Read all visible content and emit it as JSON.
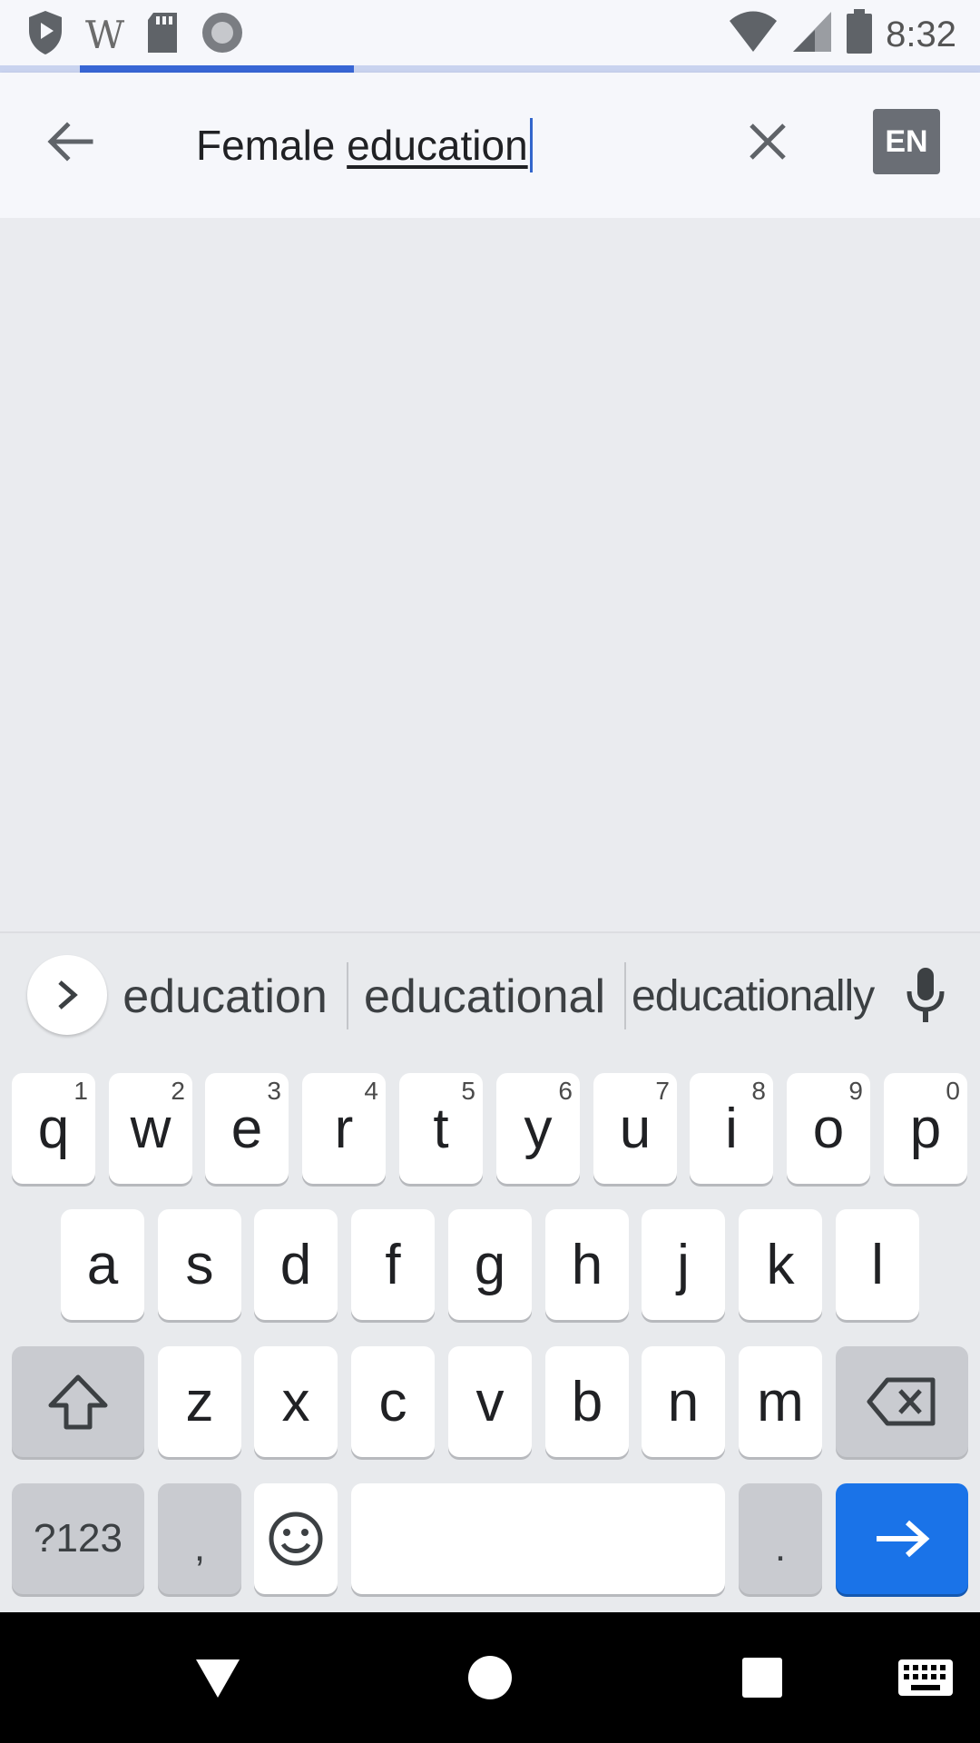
{
  "status_bar": {
    "time": "8:32",
    "wiki_letter": "W",
    "icons": [
      "play-protect-icon",
      "wikipedia-icon",
      "sd-card-icon",
      "record-icon",
      "wifi-icon",
      "signal-icon",
      "battery-icon"
    ]
  },
  "progress": {
    "fraction": 0.28
  },
  "search": {
    "text_plain": "Female ",
    "text_underlined": "education",
    "lang_label": "EN"
  },
  "keyboard": {
    "suggestions": [
      "education",
      "educational",
      "educationally"
    ],
    "row1": [
      {
        "ch": "q",
        "num": "1"
      },
      {
        "ch": "w",
        "num": "2"
      },
      {
        "ch": "e",
        "num": "3"
      },
      {
        "ch": "r",
        "num": "4"
      },
      {
        "ch": "t",
        "num": "5"
      },
      {
        "ch": "y",
        "num": "6"
      },
      {
        "ch": "u",
        "num": "7"
      },
      {
        "ch": "i",
        "num": "8"
      },
      {
        "ch": "o",
        "num": "9"
      },
      {
        "ch": "p",
        "num": "0"
      }
    ],
    "row2": [
      "a",
      "s",
      "d",
      "f",
      "g",
      "h",
      "j",
      "k",
      "l"
    ],
    "row3": [
      "z",
      "x",
      "c",
      "v",
      "b",
      "n",
      "m"
    ],
    "symbols_label": "?123",
    "comma_label": ",",
    "period_label": "."
  },
  "colors": {
    "accent_blue": "#1a73e8",
    "progress_blue": "#3866d5",
    "lang_badge": "#6a6e75"
  }
}
